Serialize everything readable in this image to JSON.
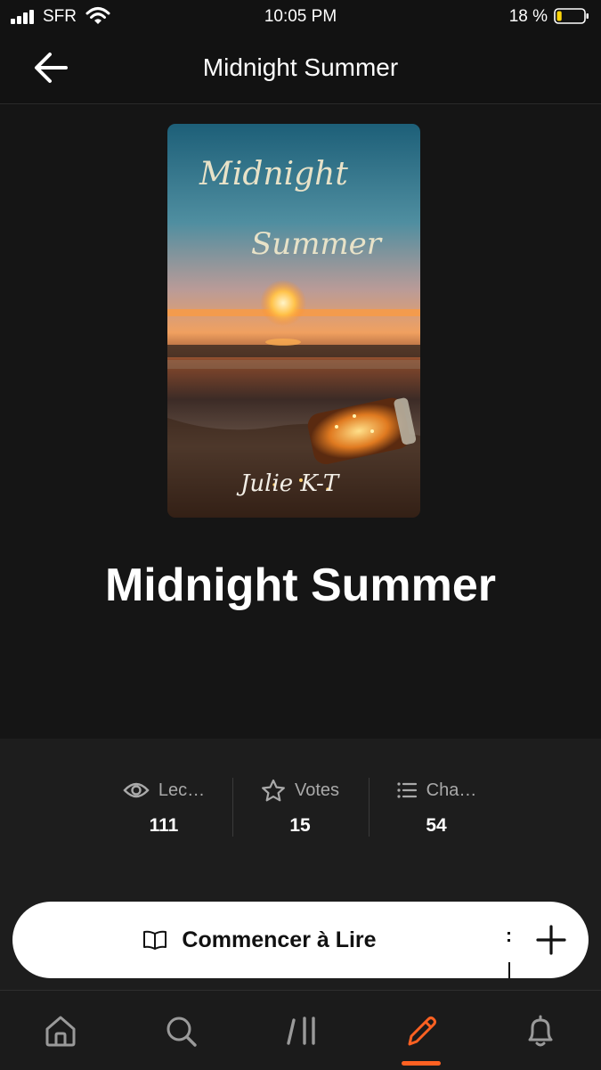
{
  "status_bar": {
    "carrier": "SFR",
    "time": "10:05 PM",
    "battery": "18 %",
    "battery_level": 0.18
  },
  "nav": {
    "title": "Midnight Summer",
    "back_icon": "arrow-left-icon"
  },
  "story": {
    "cover": {
      "title_line1": "Midnight",
      "title_line2": "Summer",
      "author_signature": "Julie K-T"
    },
    "title": "Midnight Summer"
  },
  "stats": [
    {
      "icon": "eye-icon",
      "label": "Lec…",
      "value": "111"
    },
    {
      "icon": "star-icon",
      "label": "Votes",
      "value": "15"
    },
    {
      "icon": "list-icon",
      "label": "Cha…",
      "value": "54"
    }
  ],
  "actions": {
    "read_label": "Commencer à Lire",
    "read_icon": "open-book-icon",
    "add_icon": "plus-icon"
  },
  "tabbar": {
    "tabs": [
      "home-icon",
      "search-icon",
      "library-icon",
      "write-icon",
      "bell-icon"
    ],
    "active": "write-icon",
    "accent": "#ff6122"
  }
}
